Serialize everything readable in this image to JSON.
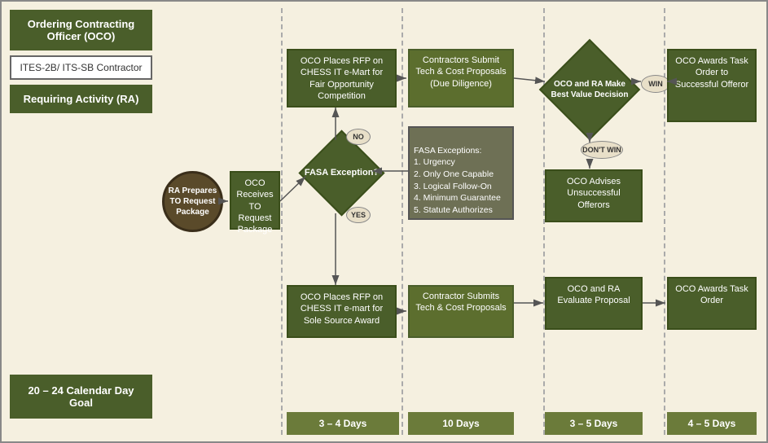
{
  "legend": {
    "oco_label": "Ordering Contracting Officer (OCO)",
    "ites_label": "ITES-2B/ ITS-SB Contractor",
    "ra_label": "Requiring Activity (RA)"
  },
  "goal": {
    "label": "20 – 24 Calendar Day Goal"
  },
  "days": {
    "col1": "3 – 4 Days",
    "col2": "10 Days",
    "col3": "3 – 5 Days",
    "col4": "4 – 5 Days"
  },
  "nodes": {
    "ra_prepares": "RA Prepares TO Request Package",
    "oco_receives": "OCO Receives TO Request Package",
    "oco_rfp_fair": "OCO Places RFP on CHESS IT e-Mart for Fair Opportunity Competition",
    "fasa": "FASA Exception?",
    "oco_rfp_sole": "OCO Places RFP on CHESS IT e-mart for Sole Source Award",
    "contractors_submit_tech": "Contractors Submit Tech & Cost Proposals (Due Diligence)",
    "contractor_submits": "Contractor Submits Tech & Cost Proposals",
    "fasa_exceptions": "FASA Exceptions:\n1. Urgency\n2. Only One Capable\n3. Logical Follow-On\n4. Minimum Guarantee\n5. Statute Authorizes",
    "oco_ra_best_value": "OCO and RA Make Best Value Decision",
    "oco_ra_evaluate": "OCO and RA Evaluate Proposal",
    "oco_advises": "OCO Advises Unsuccessful Offerors",
    "oco_awards_task": "OCO Awards Task Order to Successful Offeror",
    "oco_awards_task2": "OCO Awards Task Order",
    "win_label": "WIN",
    "dont_win_label": "DON'T WIN",
    "no_label": "NO",
    "yes_label": "YES"
  }
}
